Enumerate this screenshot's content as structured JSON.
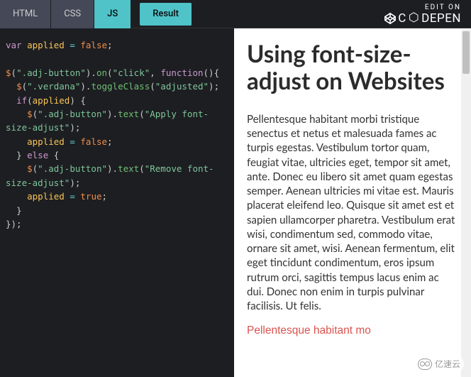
{
  "tabs": {
    "html": "HTML",
    "css": "CSS",
    "js": "JS",
    "result": "Result"
  },
  "header": {
    "edit_on": "EDIT ON",
    "logo_text": "DEPEN"
  },
  "code": {
    "line1_var": "var",
    "line1_id": " applied ",
    "line1_eq": "= ",
    "line1_false": "false",
    "line1_semi": ";",
    "line2_jq": "$",
    "line2_sel": "\".adj-button\"",
    "line2_on": "on",
    "line2_click": "\"click\"",
    "line2_func": "function",
    "line3_sel": "\".verdana\"",
    "line3_method": "toggleClass",
    "line3_arg": "\"adjusted\"",
    "line4_if": "if",
    "line4_cond": "applied",
    "line5_sel": "\".adj-button\"",
    "line5_method": "text",
    "line5_arg": "\"Apply font-size-adjust\"",
    "line6_id": "applied ",
    "line6_false": "false",
    "line7_else": "else",
    "line8_sel": "\".adj-button\"",
    "line8_method": "text",
    "line8_arg": "\"Remove font-size-adjust\"",
    "line9_id": "applied ",
    "line9_true": "true"
  },
  "result": {
    "title": "Using font-size-adjust on Websites",
    "body": "Pellentesque habitant morbi tristique senectus et netus et malesuada fames ac turpis egestas. Vestibulum tortor quam, feugiat vitae, ultricies eget, tempor sit amet, ante. Donec eu libero sit amet quam egestas semper. Aenean ultricies mi vitae est. Mauris placerat eleifend leo. Quisque sit amet est et sapien ullamcorper pharetra. Vestibulum erat wisi, condimentum sed, commodo vitae, ornare sit amet, wisi. Aenean fermentum, elit eget tincidunt condimentum, eros ipsum rutrum orci, sagittis tempus lacus enim ac dui. Donec non enim in turpis pulvinar facilisis. Ut felis.",
    "body_red": "Pellentesque habitant mo"
  },
  "watermark": {
    "text": "亿速云"
  }
}
